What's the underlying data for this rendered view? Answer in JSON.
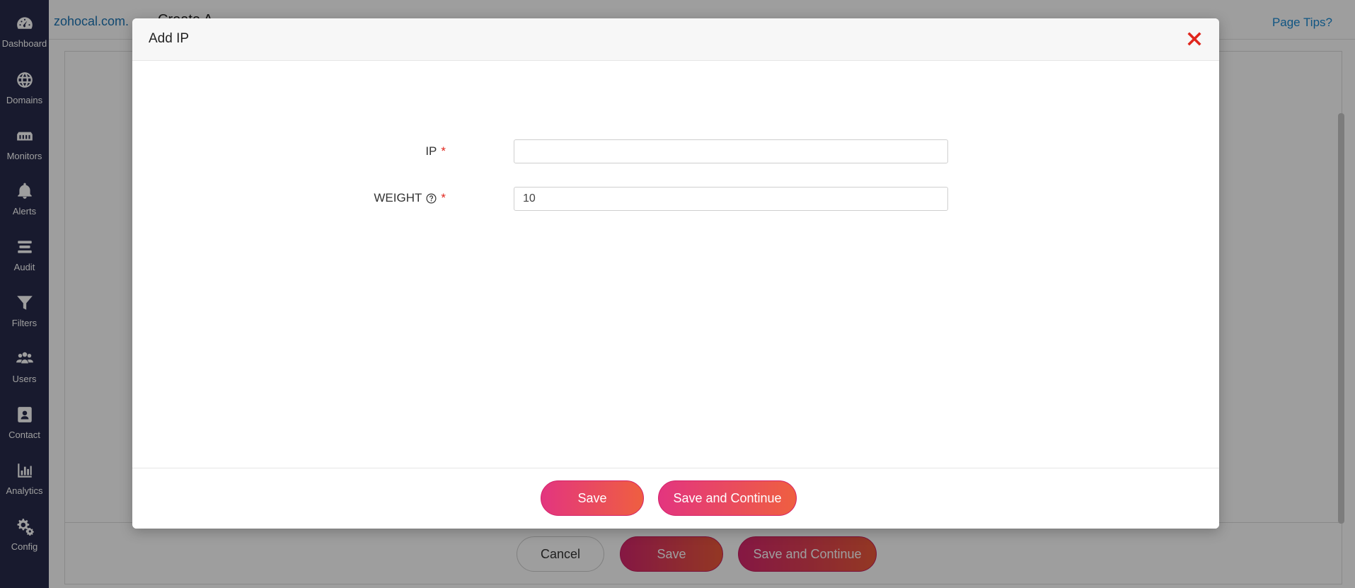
{
  "sidebar": {
    "items": [
      {
        "label": "Dashboard",
        "icon": "dashboard-icon"
      },
      {
        "label": "Domains",
        "icon": "globe-icon"
      },
      {
        "label": "Monitors",
        "icon": "monitor-icon"
      },
      {
        "label": "Alerts",
        "icon": "bell-icon"
      },
      {
        "label": "Audit",
        "icon": "audit-icon"
      },
      {
        "label": "Filters",
        "icon": "filter-icon"
      },
      {
        "label": "Users",
        "icon": "users-icon"
      },
      {
        "label": "Contact",
        "icon": "contact-icon"
      },
      {
        "label": "Analytics",
        "icon": "analytics-icon"
      },
      {
        "label": "Config",
        "icon": "gear-icon"
      }
    ]
  },
  "topbar": {
    "domain": "zohocal.com.",
    "page_title": "Create A",
    "page_tips": "Page Tips?"
  },
  "background_footer": {
    "cancel_label": "Cancel",
    "save_label": "Save",
    "save_continue_label": "Save and Continue"
  },
  "modal": {
    "title": "Add IP",
    "fields": {
      "ip": {
        "label": "IP",
        "required_mark": "*",
        "value": "",
        "placeholder": ""
      },
      "weight": {
        "label": "WEIGHT",
        "required_mark": "*",
        "value": "10"
      }
    },
    "save_label": "Save",
    "save_continue_label": "Save and Continue"
  },
  "colors": {
    "sidebar_bg": "#272b4b",
    "accent_gradient_start": "#e3357f",
    "accent_gradient_end": "#ef5f40",
    "close_red": "#e0261d",
    "link_blue": "#1b74b5"
  }
}
